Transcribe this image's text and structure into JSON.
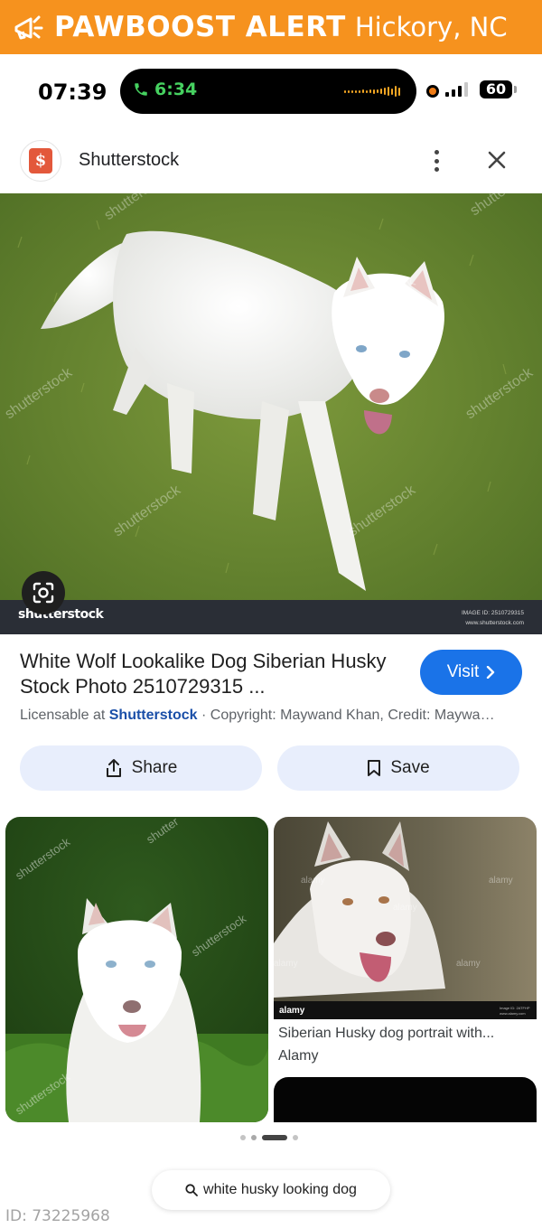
{
  "banner": {
    "title": "PAWBOOST ALERT",
    "location": "Hickory, NC",
    "icon": "megaphone-icon",
    "color": "#f6921e"
  },
  "status_bar": {
    "time": "07:39",
    "call_timer": "6:34",
    "battery": "60"
  },
  "source": {
    "name": "Shutterstock",
    "favicon": "shutterstock-icon"
  },
  "hero": {
    "watermark": "shutterstock",
    "image_id": "IMAGE ID: 2510729315",
    "site": "www.shutterstock.com"
  },
  "result": {
    "title": "White Wolf Lookalike Dog Siberian Husky Stock Photo 2510729315 ...",
    "visit_label": "Visit",
    "license_prefix": "Licensable at",
    "license_site": "Shutterstock",
    "license_rest": " · Copyright: Maywand Khan, Credit: Maywa…"
  },
  "actions": {
    "share_label": "Share",
    "save_label": "Save"
  },
  "related": {
    "right_title": "Siberian Husky dog portrait with...",
    "right_source": "Alamy",
    "left_watermark": "shutterstock",
    "right_watermark": "alamy"
  },
  "search": {
    "query": "white husky looking dog"
  },
  "pet_id": "ID: 73225968",
  "colors": {
    "accent_blue": "#1a73e8",
    "chip_bg": "#e8eefc"
  }
}
